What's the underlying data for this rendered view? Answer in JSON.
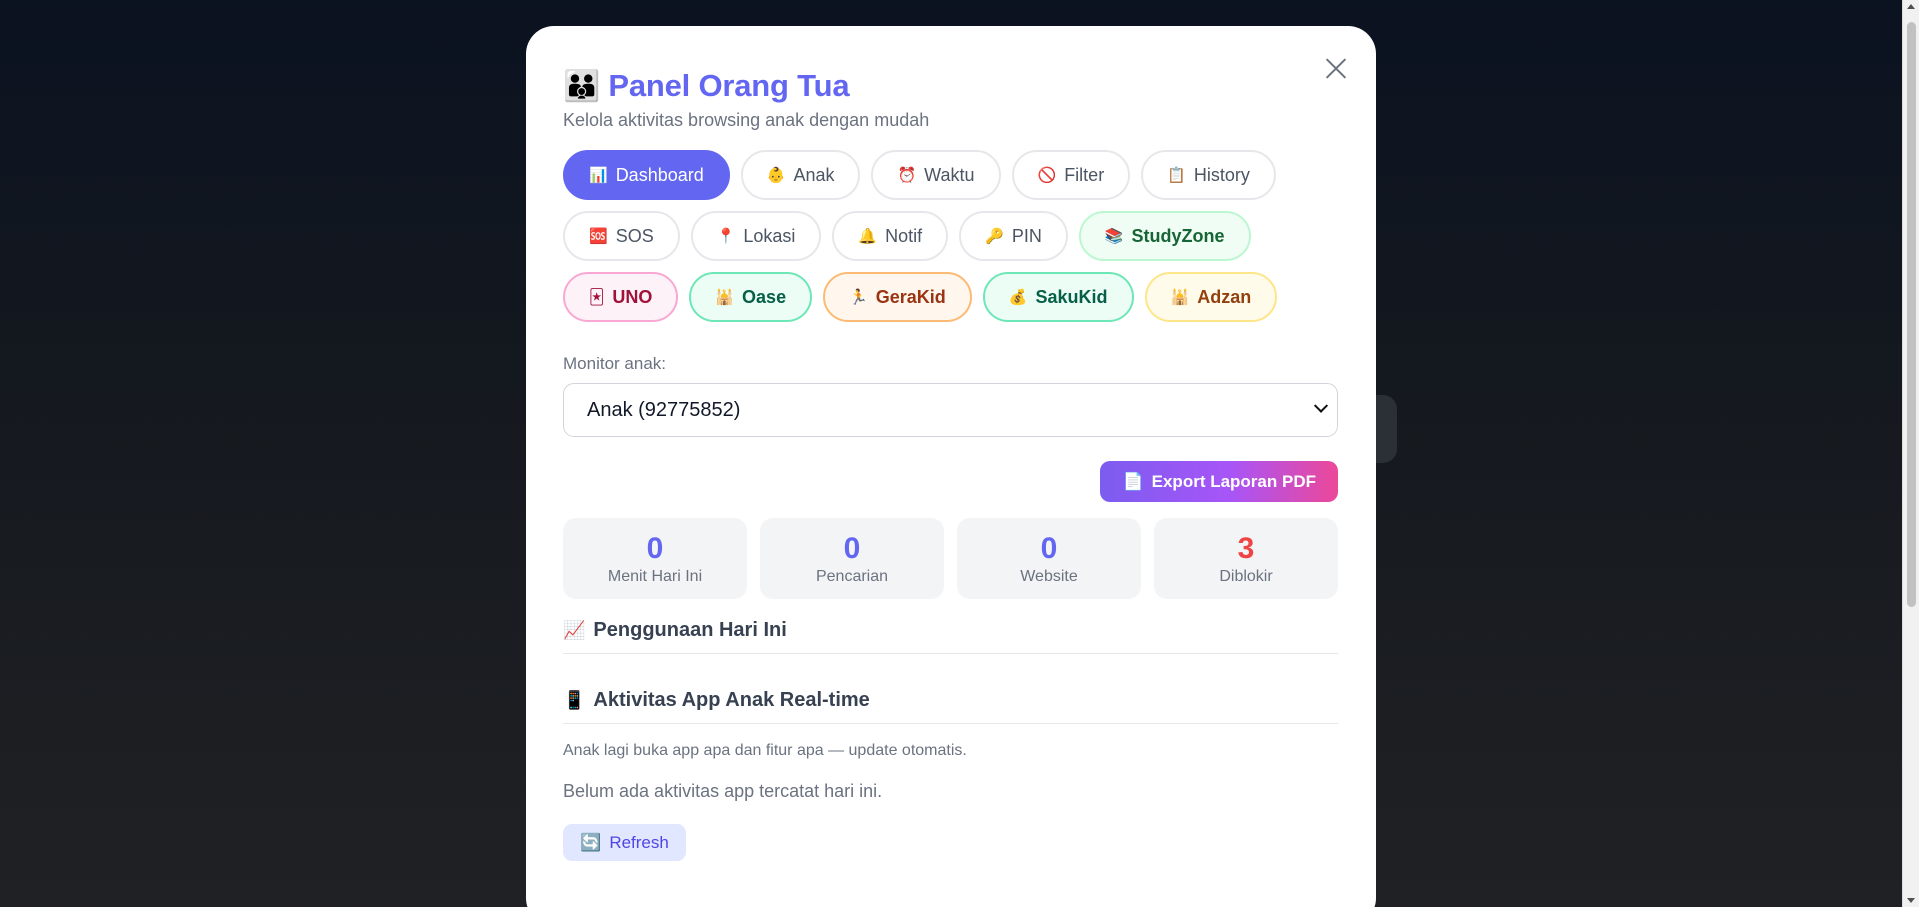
{
  "modal": {
    "title_icon": "👪",
    "title": "Panel Orang Tua",
    "subtitle": "Kelola aktivitas browsing anak dengan mudah"
  },
  "tabs": [
    {
      "icon": "📊",
      "label": "Dashboard",
      "active": true
    },
    {
      "icon": "👶",
      "label": "Anak"
    },
    {
      "icon": "⏰",
      "label": "Waktu"
    },
    {
      "icon": "🚫",
      "label": "Filter"
    },
    {
      "icon": "📋",
      "label": "History"
    },
    {
      "icon": "🆘",
      "label": "SOS"
    },
    {
      "icon": "📍",
      "label": "Lokasi"
    },
    {
      "icon": "🔔",
      "label": "Notif"
    },
    {
      "icon": "🔑",
      "label": "PIN"
    },
    {
      "icon": "📚",
      "label": "StudyZone"
    },
    {
      "icon": "🃏",
      "label": "UNO"
    },
    {
      "icon": "🕌",
      "label": "Oase"
    },
    {
      "icon": "🏃",
      "label": "GeraKid"
    },
    {
      "icon": "💰",
      "label": "SakuKid"
    },
    {
      "icon": "🕌",
      "label": "Adzan"
    }
  ],
  "monitor": {
    "label": "Monitor anak:",
    "selected": "Anak (92775852)"
  },
  "export": {
    "icon": "📄",
    "label": "Export Laporan PDF"
  },
  "stats": [
    {
      "value": "0",
      "label": "Menit Hari Ini"
    },
    {
      "value": "0",
      "label": "Pencarian"
    },
    {
      "value": "0",
      "label": "Website"
    },
    {
      "value": "3",
      "label": "Diblokir"
    }
  ],
  "usage_section": {
    "icon": "📈",
    "title": "Penggunaan Hari Ini"
  },
  "activity_section": {
    "icon": "📱",
    "title": "Aktivitas App Anak Real-time",
    "note": "Anak lagi buka app apa dan fitur apa — update otomatis.",
    "empty": "Belum ada aktivitas app tercatat hari ini.",
    "refresh_icon": "🔄",
    "refresh_label": "Refresh"
  },
  "colors": {
    "accent": "#6366f1",
    "blocked": "#ef4444"
  }
}
